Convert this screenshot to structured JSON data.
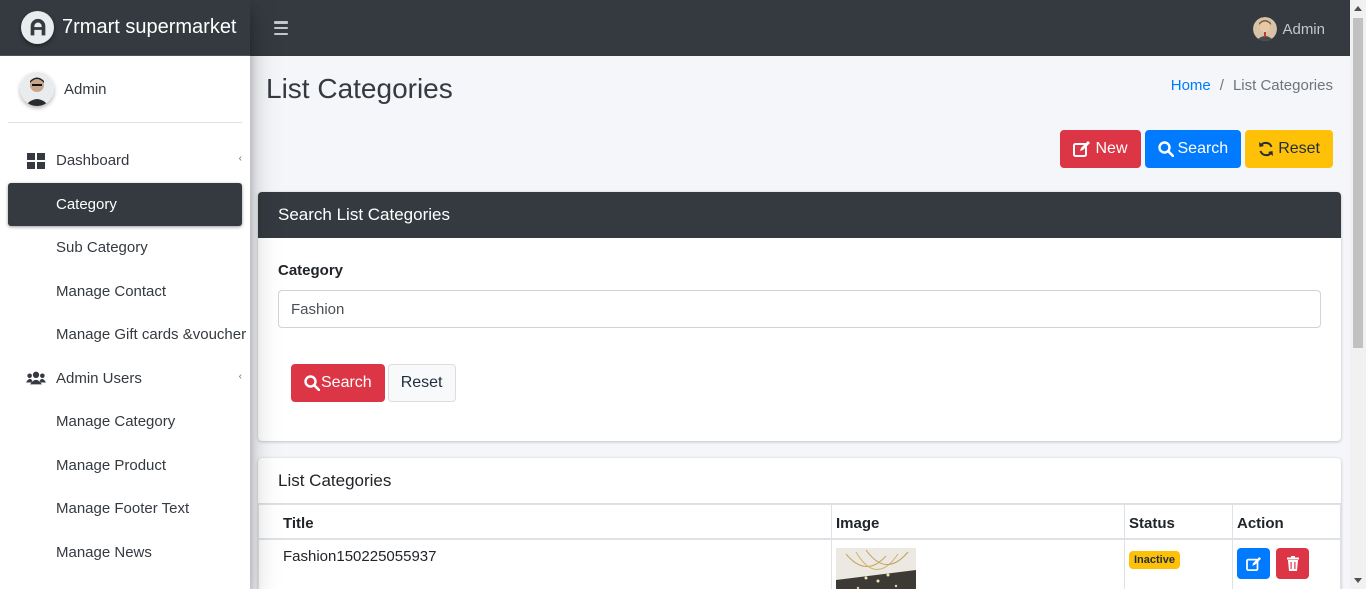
{
  "brand": {
    "name": "7rmart supermarket",
    "logo": "brand-logo-icon"
  },
  "user_panel": {
    "name": "Admin"
  },
  "navbar": {
    "user": "Admin"
  },
  "sidebar": {
    "items": [
      {
        "label": "Dashboard",
        "icon": "dashboard-icon",
        "type": "top"
      },
      {
        "label": "Category",
        "active": true
      },
      {
        "label": "Sub Category"
      },
      {
        "label": "Manage Contact"
      },
      {
        "label": "Manage Gift cards &voucher"
      },
      {
        "label": "Admin Users",
        "icon": "users-icon",
        "type": "top"
      },
      {
        "label": "Manage Category"
      },
      {
        "label": "Manage Product"
      },
      {
        "label": "Manage Footer Text"
      },
      {
        "label": "Manage News"
      }
    ]
  },
  "page": {
    "title": "List Categories",
    "breadcrumb": {
      "home": "Home",
      "separator": "/",
      "current": "List Categories"
    }
  },
  "actions": {
    "new": "New",
    "search": "Search",
    "reset": "Reset"
  },
  "search_card": {
    "title": "Search List Categories",
    "field_label": "Category",
    "field_value": "Fashion",
    "search_button": "Search",
    "reset_button": "Reset"
  },
  "list_card": {
    "title": "List Categories",
    "columns": [
      "Title",
      "Image",
      "Status",
      "Action"
    ],
    "rows": [
      {
        "title": "Fashion150225055937",
        "image": "necklace-image",
        "status": "Inactive"
      }
    ]
  },
  "colors": {
    "dark": "#343a40",
    "primary": "#007bff",
    "danger": "#dc3545",
    "warning": "#ffc107"
  }
}
